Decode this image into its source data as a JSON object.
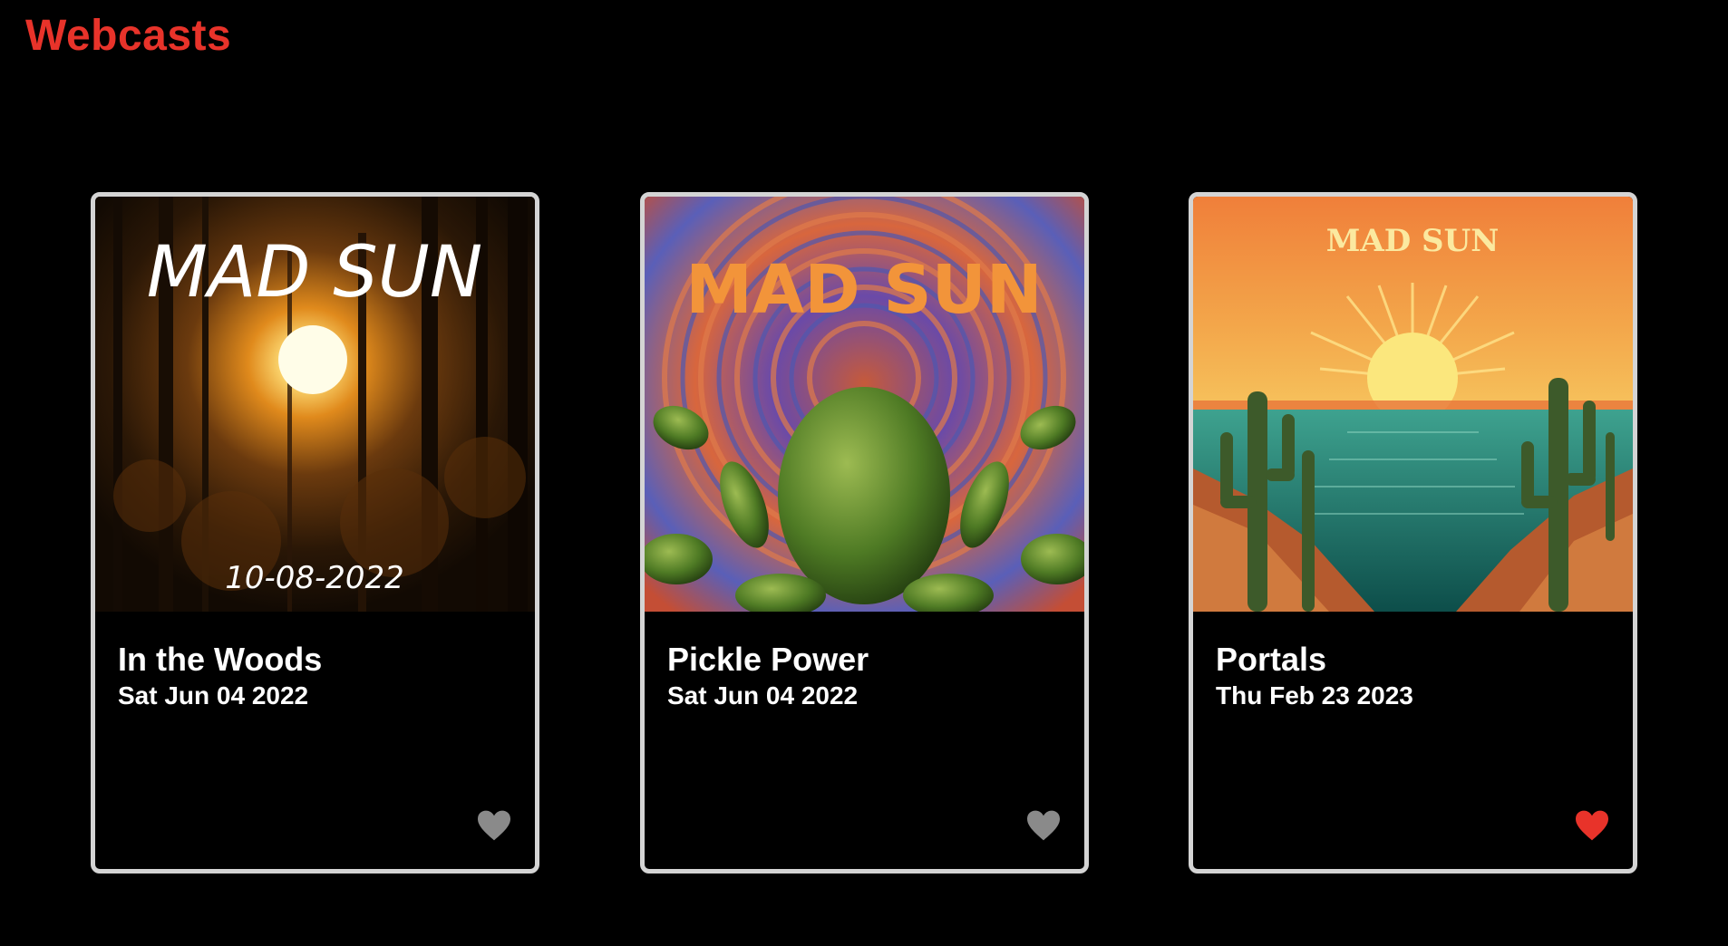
{
  "header": {
    "title": "Webcasts"
  },
  "colors": {
    "accent": "#e8332a",
    "card_border": "#d4d4d4",
    "favorite_on": "#e8332a",
    "favorite_off": "#8a8a8a"
  },
  "webcasts": [
    {
      "title": "In the Woods",
      "date": "Sat Jun 04 2022",
      "art_band": "MAD SUN",
      "art_date": "10-08-2022",
      "favorited": false,
      "icon": "heart-icon"
    },
    {
      "title": "Pickle Power",
      "date": "Sat Jun 04 2022",
      "art_band": "MAD SUN",
      "favorited": false,
      "icon": "heart-icon"
    },
    {
      "title": "Portals",
      "date": "Thu Feb 23 2023",
      "art_band": "MAD SUN",
      "favorited": true,
      "icon": "heart-icon"
    }
  ]
}
